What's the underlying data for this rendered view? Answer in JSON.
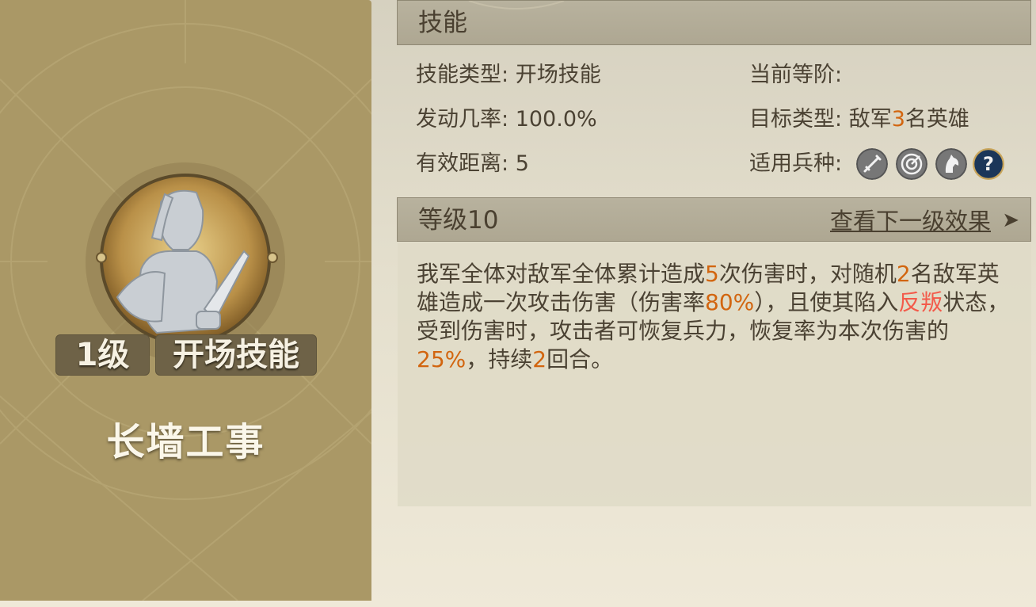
{
  "skill": {
    "name": "长墙工事",
    "level_badge": "1级",
    "type_badge": "开场技能"
  },
  "header": {
    "title": "技能"
  },
  "info": {
    "type_label": "技能类型:",
    "type_value": "开场技能",
    "current_tier_label": "当前等阶:",
    "rate_label": "发动几率:",
    "rate_value": "100.0%",
    "target_label": "目标类型:",
    "target_prefix": "敌军",
    "target_count": "3",
    "target_suffix": "名英雄",
    "range_label": "有效距离:",
    "range_value": "5",
    "troop_label": "适用兵种:",
    "troop_icons": [
      "sword-icon",
      "bow-target-icon",
      "cavalry-horse-icon",
      "question-mark-icon"
    ]
  },
  "level_bar": {
    "title": "等级10",
    "next_link": "查看下一级效果",
    "arrow": "➤"
  },
  "description": {
    "p1": "我军全体对敌军全体累计造成",
    "n1": "5",
    "p2": "次伤害时，对随机",
    "n2": "2",
    "p3": "名敌军英雄造成一次攻击伤害（伤害率",
    "n3": "80%",
    "p4": "），且使其陷入",
    "status": "反叛",
    "p5": "状态，受到伤害时，攻击者可恢复兵力，恢复率为本次伤害的",
    "n4": "25%",
    "p6": "，持续",
    "n5": "2",
    "p7": "回合。"
  },
  "colors": {
    "highlight": "#d2650f",
    "status_red": "#f35a4a",
    "left_panel": "#aa9866"
  }
}
